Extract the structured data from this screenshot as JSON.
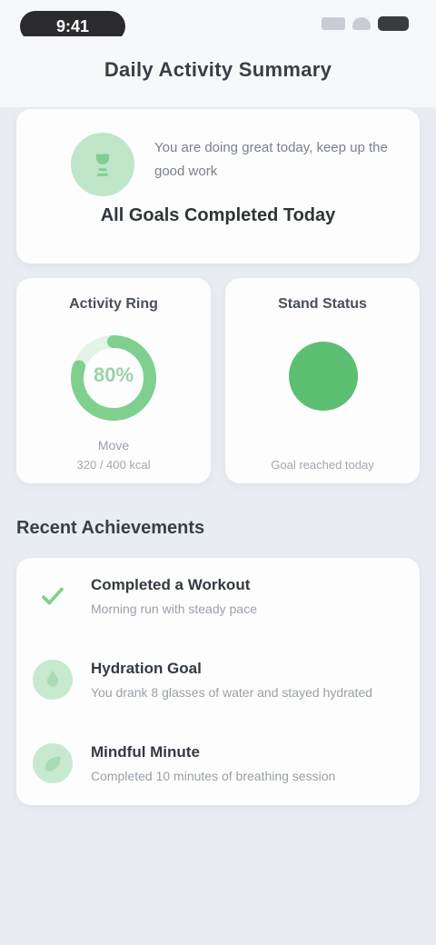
{
  "status_bar": {
    "time": "9:41"
  },
  "header": {
    "title": "Daily Activity Summary"
  },
  "summary": {
    "description": "You are doing great today, keep up the good work",
    "headline": "All Goals Completed Today"
  },
  "metrics": [
    {
      "title": "Activity Ring",
      "value": "80%",
      "label": "Move",
      "sub": "320 / 400 kcal",
      "progress": 0.8
    },
    {
      "title": "Stand Status",
      "label": "",
      "sub": "Goal reached today"
    }
  ],
  "section": {
    "title": "Recent Achievements"
  },
  "achievements": [
    {
      "title": "Completed a Workout",
      "desc": "Morning run with steady pace"
    },
    {
      "title": "Hydration Goal",
      "desc": "You drank 8 glasses of water and stayed hydrated"
    },
    {
      "title": "Mindful Minute",
      "desc": "Completed 10 minutes of breathing session"
    }
  ],
  "colors": {
    "accent": "#5cbf72",
    "accent_light": "#c6e9cf"
  }
}
